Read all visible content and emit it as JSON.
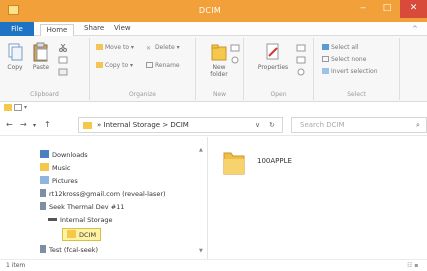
{
  "window": {
    "title": "DCIM",
    "minimize": "‒",
    "maximize": "□",
    "close": "✕"
  },
  "ribbon_tabs": {
    "file": "File",
    "home": "Home",
    "share": "Share",
    "view": "View",
    "collapse": "^"
  },
  "ribbon": {
    "clipboard": {
      "label": "Clipboard",
      "copy": "Copy",
      "paste": "Paste"
    },
    "organize": {
      "label": "Organize",
      "move_to": "Move to ▾",
      "delete": "Delete ▾",
      "copy_to": "Copy to ▾",
      "rename": "Rename"
    },
    "new": {
      "label": "New",
      "new_folder": "New folder"
    },
    "open": {
      "label": "Open",
      "properties": "Properties"
    },
    "select": {
      "label": "Select",
      "select_all": "Select all",
      "select_none": "Select none",
      "invert_selection": "Invert selection"
    }
  },
  "address": {
    "back": "←",
    "forward": "→",
    "recent": "▾",
    "up": "↑",
    "path": "» Internal Storage  >  DCIM",
    "dropdown": "∨",
    "refresh": "↻",
    "search_placeholder": "Search DCIM",
    "search_icon": "⌕"
  },
  "nav_tree": {
    "scroll_up": "▲",
    "scroll_down": "▼",
    "items": [
      {
        "label": "Downloads",
        "icon": "download-folder"
      },
      {
        "label": "Music",
        "icon": "music-folder"
      },
      {
        "label": "Pictures",
        "icon": "pictures-folder"
      },
      {
        "label": "rt12kross@gmail.com (reveal-laser)",
        "icon": "device"
      },
      {
        "label": "Seek Thermal Dev #11",
        "icon": "device"
      },
      {
        "label": "Internal Storage",
        "icon": "drive"
      },
      {
        "label": "DCIM",
        "icon": "folder"
      },
      {
        "label": "Test (fcal-seek)",
        "icon": "device"
      }
    ]
  },
  "content": {
    "folders": [
      {
        "label": "100APPLE"
      }
    ]
  },
  "status": {
    "count": "1 item",
    "view_icons": "☷ ▪"
  }
}
